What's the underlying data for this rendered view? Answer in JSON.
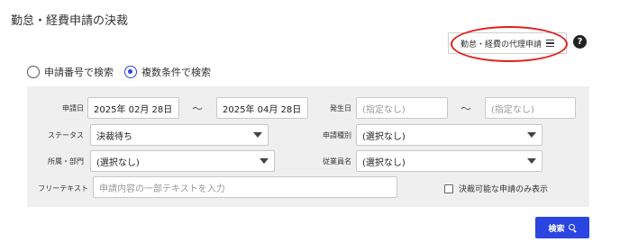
{
  "page": {
    "title": "勤怠・経費申請の決裁"
  },
  "header": {
    "proxy_button_label": "勤怠・経費の代理申請",
    "help_icon": "question-circle-icon",
    "help_glyph": "?"
  },
  "search_mode": {
    "options": [
      {
        "label": "申請番号で検索",
        "selected": false
      },
      {
        "label": "複数条件で検索",
        "selected": true
      }
    ]
  },
  "filters": {
    "application_date": {
      "label": "申請日",
      "from": "2025年 02月 28日",
      "separator": "〜",
      "to": "2025年 04月 28日"
    },
    "occurrence_date": {
      "label": "発生日",
      "from_placeholder": "(指定なし)",
      "separator": "〜",
      "to_placeholder": "(指定なし)"
    },
    "status": {
      "label": "ステータス",
      "value": "決裁待ち"
    },
    "application_type": {
      "label": "申請種別",
      "value": "(選択なし)"
    },
    "department": {
      "label": "所属・部門",
      "value": "(選択なし)"
    },
    "employee_name": {
      "label": "従業員名",
      "value": "(選択なし)"
    },
    "free_text": {
      "label": "フリーテキスト",
      "placeholder": "申請内容の一部テキストを入力"
    },
    "approvable_only": {
      "label": "決裁可能な申請のみ表示",
      "checked": false
    }
  },
  "actions": {
    "search_label": "検索"
  },
  "colors": {
    "accent": "#2b45e0",
    "highlight": "#e01e1e",
    "panel": "#efefef"
  }
}
